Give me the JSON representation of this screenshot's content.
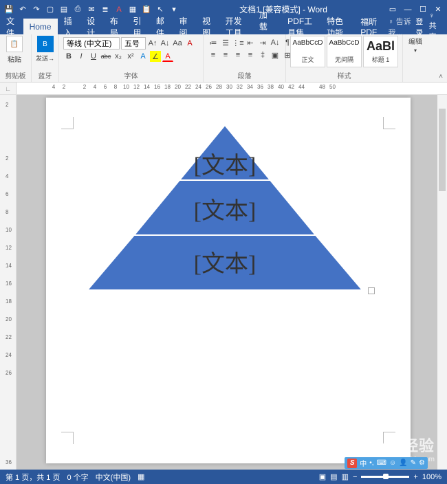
{
  "title": "文档1 [兼容模式] - Word",
  "qat": [
    "save",
    "undo",
    "redo",
    "new",
    "open",
    "print",
    "mail",
    "bullets",
    "fontcolor",
    "table",
    "view",
    "paste",
    "pointer"
  ],
  "tabs": {
    "file": "文件",
    "list": [
      "Home",
      "插入",
      "设计",
      "布局",
      "引用",
      "邮件",
      "审阅",
      "视图",
      "开发工具",
      "加载项",
      "PDF工具集",
      "特色功能",
      "福昕PDF"
    ],
    "active": "Home",
    "tell_me": "告诉我…",
    "signin": "登录",
    "share": "共享"
  },
  "ribbon": {
    "clipboard": {
      "label": "剪贴板",
      "paste": "粘贴",
      "send": "发送→",
      "bt": "蓝牙"
    },
    "font": {
      "label": "字体",
      "name": "等线 (中文正)",
      "size": "五号",
      "buttons_row1": [
        "A↑",
        "A↓",
        "Aa",
        "A"
      ],
      "buttons_row2": [
        "B",
        "I",
        "U",
        "abc",
        "x₂",
        "x²",
        "A",
        "∠",
        "A"
      ]
    },
    "paragraph": {
      "label": "段落"
    },
    "styles": {
      "label": "样式",
      "items": [
        {
          "sample": "AaBbCcD",
          "name": "正文"
        },
        {
          "sample": "AaBbCcD",
          "name": "无间隔"
        },
        {
          "sample": "AaBl",
          "name": "标题 1"
        }
      ]
    },
    "editing": {
      "label": "编辑"
    }
  },
  "chart_data": {
    "type": "pyramid",
    "levels": [
      {
        "text": "[文本]"
      },
      {
        "text": "[文本]"
      },
      {
        "text": "[文本]"
      }
    ],
    "fill": "#4472c4",
    "stroke": "#ffffff"
  },
  "ruler": [
    "4",
    "2",
    "",
    "2",
    "4",
    "6",
    "8",
    "10",
    "12",
    "14",
    "16",
    "18",
    "20",
    "22",
    "24",
    "26",
    "28",
    "30",
    "32",
    "34",
    "36",
    "38",
    "40",
    "42",
    "44",
    "",
    "48",
    "50"
  ],
  "vruler": [
    "2",
    "",
    "",
    "2",
    "4",
    "6",
    "8",
    "10",
    "12",
    "14",
    "16",
    "18",
    "20",
    "22",
    "24",
    "26",
    "",
    "",
    "",
    "",
    "36"
  ],
  "status": {
    "page": "第 1 页，共 1 页",
    "words": "0 个字",
    "lang": "中文(中国)",
    "zoom": "100%"
  },
  "watermark": {
    "brand": "Baidu 经验",
    "url": "jingyan.baidu.com"
  },
  "ime": {
    "label": "中"
  }
}
